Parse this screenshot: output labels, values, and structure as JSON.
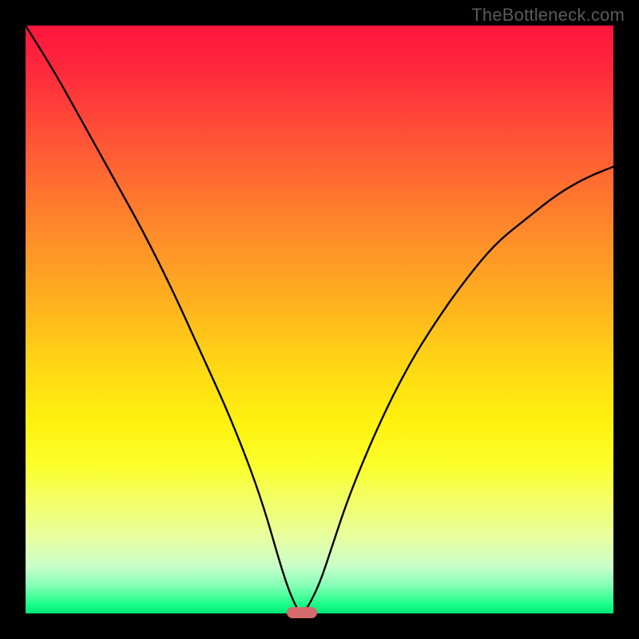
{
  "watermark": "TheBottleneck.com",
  "chart_data": {
    "type": "line",
    "title": "",
    "xlabel": "",
    "ylabel": "",
    "xlim": [
      0,
      100
    ],
    "ylim": [
      0,
      100
    ],
    "background_gradient": {
      "direction": "vertical",
      "stops": [
        {
          "pos": 0,
          "color": "#ff153e",
          "meaning": "severe-bottleneck"
        },
        {
          "pos": 50,
          "color": "#ffd814",
          "meaning": "moderate"
        },
        {
          "pos": 100,
          "color": "#00e676",
          "meaning": "no-bottleneck"
        }
      ]
    },
    "series": [
      {
        "name": "bottleneck-curve",
        "x": [
          0,
          5,
          10,
          15,
          20,
          25,
          30,
          35,
          40,
          44,
          46,
          47,
          48,
          50,
          52,
          55,
          60,
          65,
          70,
          75,
          80,
          85,
          90,
          95,
          100
        ],
        "y": [
          100,
          92,
          83,
          74,
          65,
          55,
          44,
          33,
          20,
          6,
          1,
          0,
          1,
          5,
          11,
          20,
          32,
          42,
          50,
          57,
          63,
          67,
          71,
          74,
          76
        ]
      }
    ],
    "marker": {
      "x": 47,
      "y": 0,
      "color": "#d66b6e",
      "shape": "pill"
    }
  }
}
